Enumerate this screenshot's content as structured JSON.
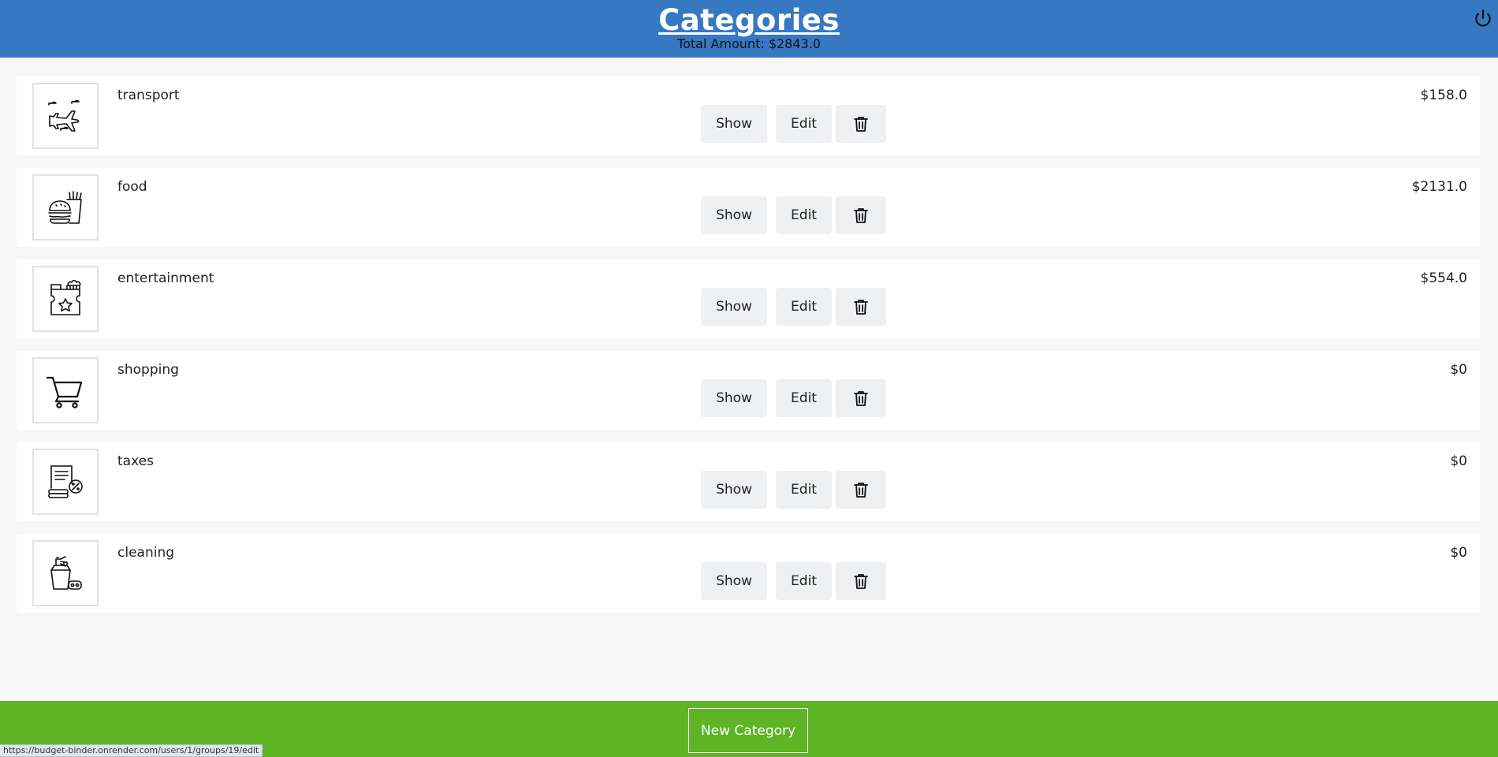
{
  "header": {
    "title": "Categories",
    "total": "Total Amount: $2843.0"
  },
  "icons": {
    "power": "power-icon",
    "delete": "trash-icon"
  },
  "buttons": {
    "show": "Show",
    "edit": "Edit"
  },
  "categories": [
    {
      "name": "transport",
      "amount": "$158.0",
      "icon": "airplane-icon"
    },
    {
      "name": "food",
      "amount": "$2131.0",
      "icon": "burger-fries-icon"
    },
    {
      "name": "entertainment",
      "amount": "$554.0",
      "icon": "cinema-ticket-icon"
    },
    {
      "name": "shopping",
      "amount": "$0",
      "icon": "shopping-cart-icon"
    },
    {
      "name": "taxes",
      "amount": "$0",
      "icon": "tax-document-icon"
    },
    {
      "name": "cleaning",
      "amount": "$0",
      "icon": "cleaning-supplies-icon"
    }
  ],
  "footer": {
    "new_category": "New Category"
  },
  "statusbar": {
    "url": "https://budget-binder.onrender.com/users/1/groups/19/edit"
  },
  "colors": {
    "header": "#3778c2",
    "footer": "#5eb424",
    "background": "#f7f7f7"
  }
}
